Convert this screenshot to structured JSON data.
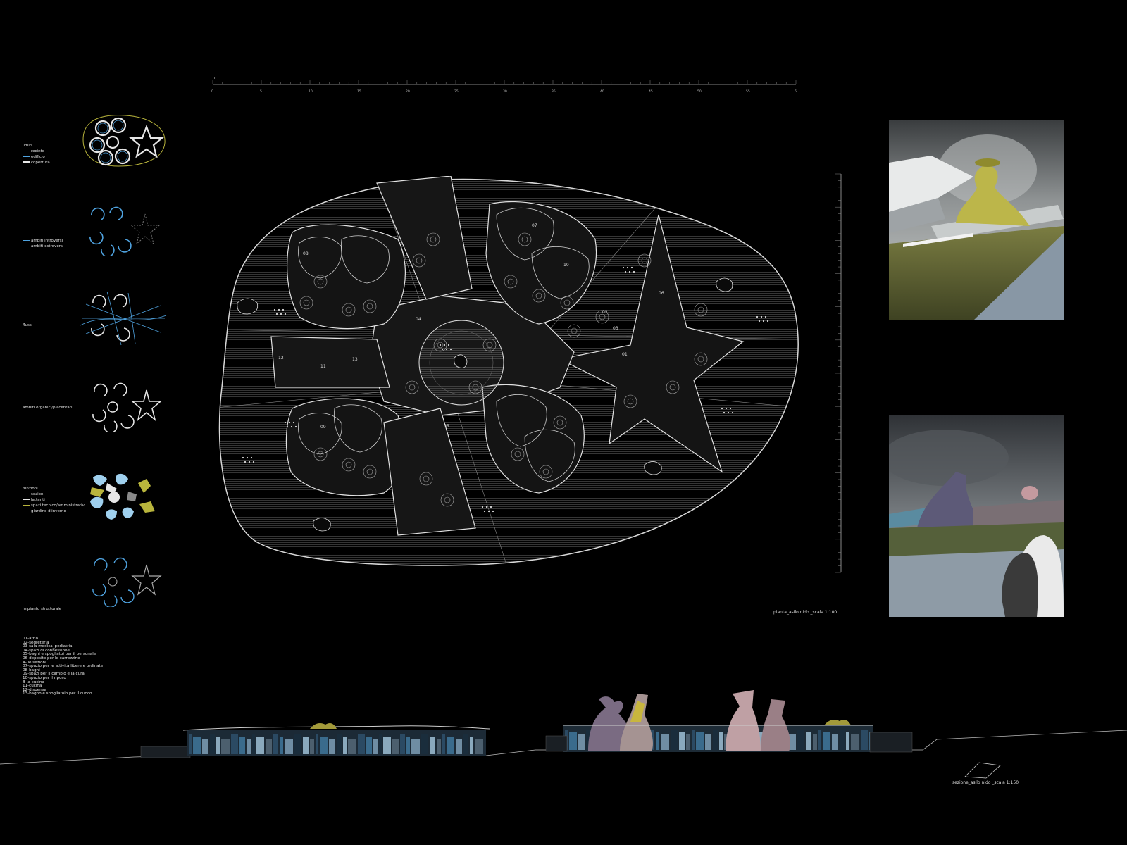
{
  "diagrams": [
    {
      "id": "limiti",
      "title": "limiti",
      "items": [
        {
          "label": "recinto",
          "color": "#b8b43c"
        },
        {
          "label": "edificio",
          "color": "#4fa3e0"
        },
        {
          "label": "copertura",
          "color": "#e6e6e6"
        }
      ]
    },
    {
      "id": "ambiti",
      "title": "",
      "items": [
        {
          "label": "ambiti introversi",
          "color": "#4fa3e0"
        },
        {
          "label": "ambiti estroversi",
          "color": "#e6e6e6"
        }
      ]
    },
    {
      "id": "flussi",
      "title": "flussi",
      "items": []
    },
    {
      "id": "organici",
      "title": "ambiti organici/placentari",
      "items": []
    },
    {
      "id": "funzioni",
      "title": "funzioni",
      "items": [
        {
          "label": "sezioni",
          "color": "#4fa3e0"
        },
        {
          "label": "lattanti",
          "color": "#e6e6e6"
        },
        {
          "label": "spazi tecnico/amministrativi",
          "color": "#b8b43c"
        },
        {
          "label": "giardino d'inverno",
          "color": "#8a8a8a"
        }
      ]
    },
    {
      "id": "strutturale",
      "title": "impianto strutturale",
      "items": []
    }
  ],
  "legend": [
    "01-atrio",
    "02-segreteria",
    "03-sala medica_pediatria",
    "04-spazi di connessione",
    "05-bagni e spogliatoi per il personale",
    "06-deposito per le carrozzine",
    "A- le sezioni",
    "07-spazio per le attività libere e ordinate",
    "08-bagni",
    "09-spazi per il cambio e la cura",
    "10-spazio per il riposo",
    "B-la cucina",
    "11-cucina",
    "12-dispensa",
    "13-bagno e spogliatoio per il cuoco"
  ],
  "plan": {
    "caption": "pianta_asilo nido _scala 1:100",
    "scale_unit": "m",
    "scale_ticks": [
      "0",
      "5",
      "10",
      "15",
      "20",
      "25",
      "30",
      "35",
      "40",
      "45",
      "50",
      "55",
      "60"
    ],
    "rooms": [
      "01",
      "02",
      "03",
      "04",
      "05",
      "06",
      "07",
      "08",
      "09",
      "10",
      "11",
      "12",
      "13"
    ]
  },
  "section": {
    "caption": "sezione_asilo nido _scala 1:150"
  },
  "renders": [
    {
      "name": "render-exterior-1"
    },
    {
      "name": "render-exterior-2"
    }
  ],
  "colors": {
    "accent_blue": "#4fa3e0",
    "accent_olive": "#b8b43c",
    "line": "#cfcfcf"
  }
}
